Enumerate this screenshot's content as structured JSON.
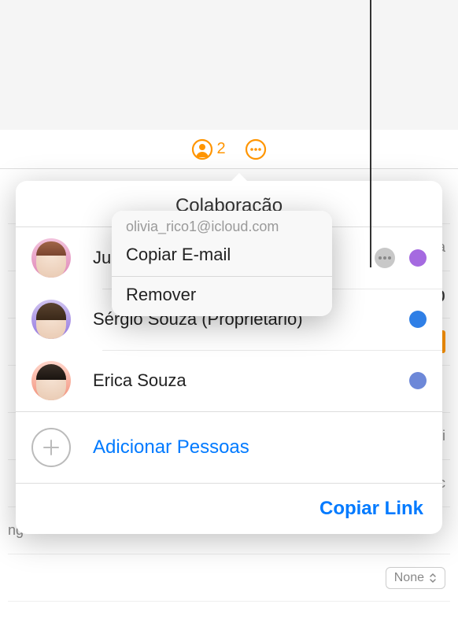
{
  "toolbar": {
    "collab_count": "2"
  },
  "popover": {
    "title": "Colaboração",
    "people": [
      {
        "name": "Ju",
        "color": "#a56ae0"
      },
      {
        "name": "Sérgio Souza (Proprietário)",
        "color": "#2f7fe6"
      },
      {
        "name": "Erica Souza",
        "color": "#6d88d8"
      }
    ],
    "add_label": "Adicionar Pessoas",
    "copy_link": "Copiar Link"
  },
  "context_menu": {
    "email": "olivia_rico1@icloud.com",
    "copy_email": "Copiar E-mail",
    "remove": "Remover"
  },
  "background": {
    "select_value": "None"
  }
}
